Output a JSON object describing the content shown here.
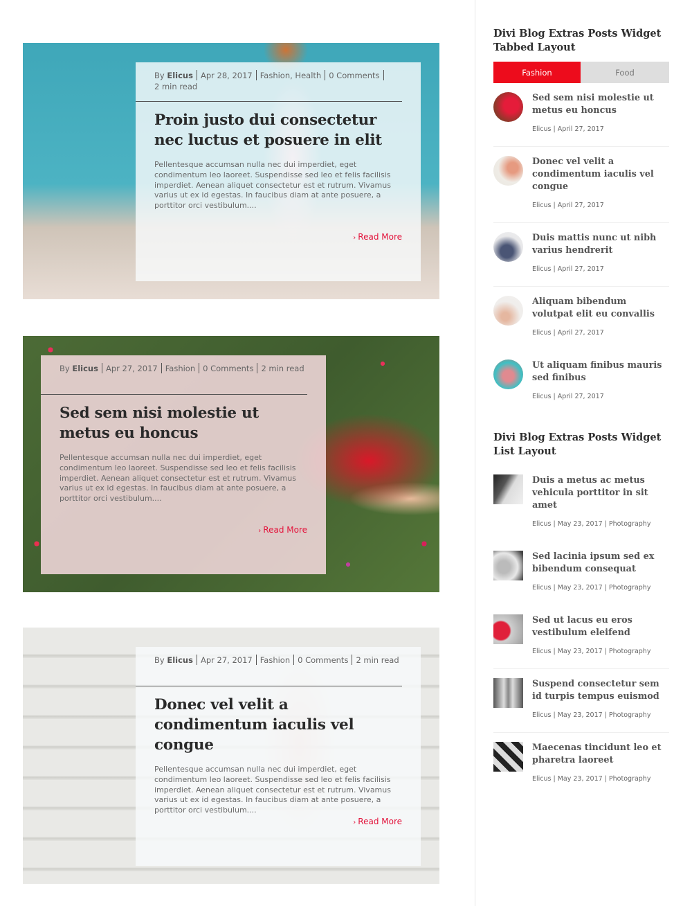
{
  "posts": [
    {
      "author_prefix": "By",
      "author": "Elicus",
      "date": "Apr 28, 2017",
      "categories": "Fashion, Health",
      "comments": "0 Comments",
      "read_time": "2 min read",
      "title": "Proin justo dui consectetur nec luctus et posuere in elit",
      "excerpt": "Pellentesque accumsan nulla nec dui imperdiet, eget condimentum leo laoreet. Suspendisse sed leo et felis facilisis imperdiet. Aenean aliquet consectetur est et rutrum. Vivamus varius ut ex id egestas. In faucibus diam at ante posuere, a porttitor orci vestibulum....",
      "read_more": "Read More"
    },
    {
      "author_prefix": "By",
      "author": "Elicus",
      "date": "Apr 27, 2017",
      "categories": "Fashion",
      "comments": "0 Comments",
      "read_time": "2 min read",
      "title": "Sed sem nisi molestie ut metus eu honcus",
      "excerpt": "Pellentesque accumsan nulla nec dui imperdiet, eget condimentum leo laoreet. Suspendisse sed leo et felis facilisis imperdiet. Aenean aliquet consectetur est et rutrum. Vivamus varius ut ex id egestas. In faucibus diam at ante posuere, a porttitor orci vestibulum....",
      "read_more": "Read More"
    },
    {
      "author_prefix": "By",
      "author": "Elicus",
      "date": "Apr 27, 2017",
      "categories": "Fashion",
      "comments": "0 Comments",
      "read_time": "2 min read",
      "title": "Donec vel velit a condimentum iaculis vel congue",
      "excerpt": "Pellentesque accumsan nulla nec dui imperdiet, eget condimentum leo laoreet. Suspendisse sed leo et felis facilisis imperdiet. Aenean aliquet consectetur est et rutrum. Vivamus varius ut ex id egestas. In faucibus diam at ante posuere, a porttitor orci vestibulum....",
      "read_more": "Read More"
    }
  ],
  "sidebar": {
    "tabbed_widget": {
      "title": "Divi Blog Extras Posts Widget Tabbed Layout",
      "tabs": [
        {
          "label": "Fashion",
          "active": true
        },
        {
          "label": "Food",
          "active": false
        }
      ],
      "items": [
        {
          "title": "Sed sem nisi molestie ut metus eu honcus",
          "meta": "Elicus | April 27, 2017"
        },
        {
          "title": "Donec vel velit a condimentum iaculis vel congue",
          "meta": "Elicus | April 27, 2017"
        },
        {
          "title": "Duis mattis nunc ut nibh varius hendrerit",
          "meta": "Elicus | April 27, 2017"
        },
        {
          "title": "Aliquam bibendum volutpat elit eu convallis",
          "meta": "Elicus | April 27, 2017"
        },
        {
          "title": "Ut aliquam finibus mauris sed finibus",
          "meta": "Elicus | April 27, 2017"
        }
      ]
    },
    "list_widget": {
      "title": "Divi Blog Extras Posts Widget List Layout",
      "items": [
        {
          "title": "Duis a metus ac metus vehicula porttitor in sit amet",
          "meta": "Elicus | May 23, 2017 | Photography"
        },
        {
          "title": "Sed lacinia ipsum sed ex bibendum consequat",
          "meta": "Elicus | May 23, 2017 | Photography"
        },
        {
          "title": "Sed ut lacus eu eros vestibulum eleifend",
          "meta": "Elicus | May 23, 2017 | Photography"
        },
        {
          "title": "Suspend consectetur sem id turpis tempus euismod",
          "meta": "Elicus | May 23, 2017 | Photography"
        },
        {
          "title": "Maecenas tincidunt leo et pharetra laoreet",
          "meta": "Elicus | May 23, 2017 | Photography"
        }
      ]
    }
  },
  "colors": {
    "accent_red": "#ed0c1c",
    "read_more": "#e3133b",
    "tab_inactive_bg": "#dedede"
  },
  "icons": {
    "read_more_chevron": "›"
  }
}
